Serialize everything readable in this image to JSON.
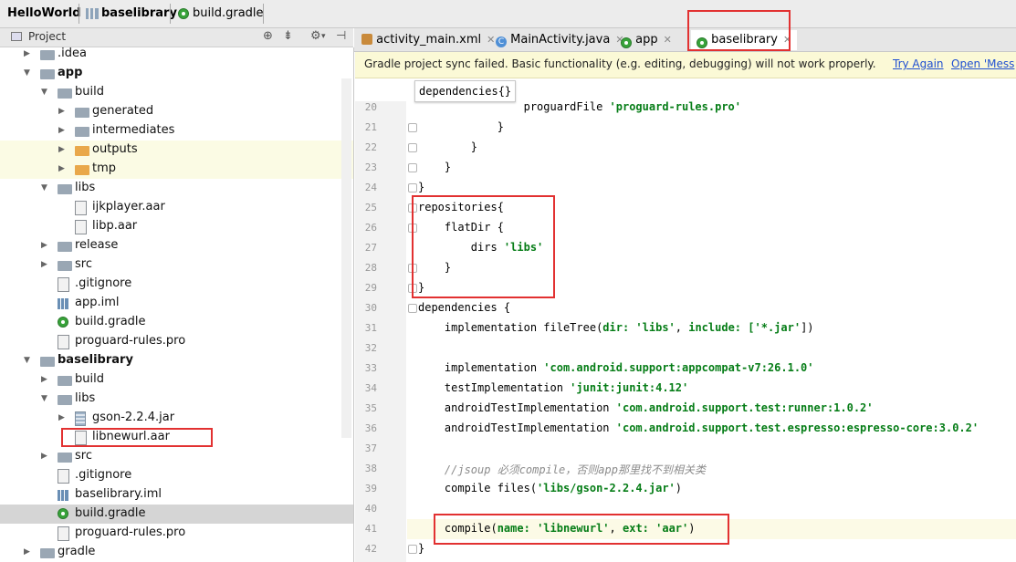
{
  "breadcrumb": [
    "HelloWorld",
    "baselibrary",
    "build.gradle"
  ],
  "project_panel": {
    "title": "Project",
    "tools": [
      "target-icon",
      "collapse-icon",
      "gear-icon",
      "hide-icon"
    ]
  },
  "tree": [
    {
      "label": ".idea",
      "indent": 1,
      "arrow": "right",
      "icon": "folder"
    },
    {
      "label": "app",
      "indent": 1,
      "arrow": "down",
      "icon": "module",
      "bold": true
    },
    {
      "label": "build",
      "indent": 2,
      "arrow": "down",
      "icon": "folder"
    },
    {
      "label": "generated",
      "indent": 3,
      "arrow": "right",
      "icon": "folder"
    },
    {
      "label": "intermediates",
      "indent": 3,
      "arrow": "right",
      "icon": "folder"
    },
    {
      "label": "outputs",
      "indent": 3,
      "arrow": "right",
      "icon": "folder-orange",
      "highlight": true
    },
    {
      "label": "tmp",
      "indent": 3,
      "arrow": "right",
      "icon": "folder-orange",
      "highlight": true
    },
    {
      "label": "libs",
      "indent": 2,
      "arrow": "down",
      "icon": "folder"
    },
    {
      "label": "ijkplayer.aar",
      "indent": 3,
      "arrow": "none",
      "icon": "file"
    },
    {
      "label": "libp.aar",
      "indent": 3,
      "arrow": "none",
      "icon": "file"
    },
    {
      "label": "release",
      "indent": 2,
      "arrow": "right",
      "icon": "folder"
    },
    {
      "label": "src",
      "indent": 2,
      "arrow": "right",
      "icon": "folder"
    },
    {
      "label": ".gitignore",
      "indent": 2,
      "arrow": "none",
      "icon": "file"
    },
    {
      "label": "app.iml",
      "indent": 2,
      "arrow": "none",
      "icon": "iml"
    },
    {
      "label": "build.gradle",
      "indent": 2,
      "arrow": "none",
      "icon": "gradle"
    },
    {
      "label": "proguard-rules.pro",
      "indent": 2,
      "arrow": "none",
      "icon": "file"
    },
    {
      "label": "baselibrary",
      "indent": 1,
      "arrow": "down",
      "icon": "module",
      "bold": true
    },
    {
      "label": "build",
      "indent": 2,
      "arrow": "right",
      "icon": "folder"
    },
    {
      "label": "libs",
      "indent": 2,
      "arrow": "down",
      "icon": "folder"
    },
    {
      "label": "gson-2.2.4.jar",
      "indent": 3,
      "arrow": "right",
      "icon": "jar"
    },
    {
      "label": "libnewurl.aar",
      "indent": 3,
      "arrow": "none",
      "icon": "file"
    },
    {
      "label": "src",
      "indent": 2,
      "arrow": "right",
      "icon": "folder"
    },
    {
      "label": ".gitignore",
      "indent": 2,
      "arrow": "none",
      "icon": "file"
    },
    {
      "label": "baselibrary.iml",
      "indent": 2,
      "arrow": "none",
      "icon": "iml"
    },
    {
      "label": "build.gradle",
      "indent": 2,
      "arrow": "none",
      "icon": "gradle",
      "selected": true
    },
    {
      "label": "proguard-rules.pro",
      "indent": 2,
      "arrow": "none",
      "icon": "file"
    },
    {
      "label": "gradle",
      "indent": 1,
      "arrow": "right",
      "icon": "folder"
    }
  ],
  "tabs": [
    {
      "label": "activity_main.xml",
      "icon": "xml-icon"
    },
    {
      "label": "MainActivity.java",
      "icon": "class-icon"
    },
    {
      "label": "app",
      "icon": "gradle-icon"
    },
    {
      "label": "baselibrary",
      "icon": "gradle-icon",
      "active": true
    }
  ],
  "notification": {
    "message": "Gradle project sync failed. Basic functionality (e.g. editing, debugging) will not work properly.",
    "try_again": "Try Again",
    "open_messages": "Open 'Mess"
  },
  "hint": "dependencies{}",
  "code_lines": [
    {
      "n": "20",
      "segs": [
        {
          "t": "                proguardFile "
        },
        {
          "t": "'proguard-rules.pro'",
          "c": "str"
        }
      ]
    },
    {
      "n": "21",
      "segs": [
        {
          "t": "            }"
        }
      ]
    },
    {
      "n": "22",
      "segs": [
        {
          "t": "        }"
        }
      ]
    },
    {
      "n": "23",
      "segs": [
        {
          "t": "    }"
        }
      ]
    },
    {
      "n": "24",
      "segs": [
        {
          "t": "}"
        }
      ]
    },
    {
      "n": "25",
      "segs": [
        {
          "t": "repositories{"
        }
      ]
    },
    {
      "n": "26",
      "segs": [
        {
          "t": "    flatDir {"
        }
      ]
    },
    {
      "n": "27",
      "segs": [
        {
          "t": "        dirs "
        },
        {
          "t": "'libs'",
          "c": "str"
        }
      ]
    },
    {
      "n": "28",
      "segs": [
        {
          "t": "    }"
        }
      ]
    },
    {
      "n": "29",
      "segs": [
        {
          "t": "}"
        }
      ]
    },
    {
      "n": "30",
      "segs": [
        {
          "t": "dependencies {"
        }
      ]
    },
    {
      "n": "31",
      "segs": [
        {
          "t": "    implementation fileTree("
        },
        {
          "t": "dir: ",
          "c": "nm"
        },
        {
          "t": "'libs'",
          "c": "str"
        },
        {
          "t": ", "
        },
        {
          "t": "include: ",
          "c": "nm"
        },
        {
          "t": "['*.jar'",
          "c": "str"
        },
        {
          "t": "])"
        }
      ]
    },
    {
      "n": "32",
      "segs": []
    },
    {
      "n": "33",
      "segs": [
        {
          "t": "    implementation "
        },
        {
          "t": "'com.android.support:appcompat-v7:26.1.0'",
          "c": "str"
        }
      ]
    },
    {
      "n": "34",
      "segs": [
        {
          "t": "    testImplementation "
        },
        {
          "t": "'junit:junit:4.12'",
          "c": "str"
        }
      ]
    },
    {
      "n": "35",
      "segs": [
        {
          "t": "    androidTestImplementation "
        },
        {
          "t": "'com.android.support.test:runner:1.0.2'",
          "c": "str"
        }
      ]
    },
    {
      "n": "36",
      "segs": [
        {
          "t": "    androidTestImplementation "
        },
        {
          "t": "'com.android.support.test.espresso:espresso-core:3.0.2'",
          "c": "str"
        }
      ]
    },
    {
      "n": "37",
      "segs": []
    },
    {
      "n": "38",
      "segs": [
        {
          "t": "    //jsoup 必须compile，否则app那里找不到相关类",
          "c": "cmt"
        }
      ]
    },
    {
      "n": "39",
      "segs": [
        {
          "t": "    compile files("
        },
        {
          "t": "'libs/gson-2.2.4.jar'",
          "c": "str"
        },
        {
          "t": ")"
        }
      ]
    },
    {
      "n": "40",
      "segs": []
    },
    {
      "n": "41",
      "segs": [
        {
          "t": "    compile("
        },
        {
          "t": "name: ",
          "c": "nm"
        },
        {
          "t": "'libnewurl'",
          "c": "str"
        },
        {
          "t": ", "
        },
        {
          "t": "ext: ",
          "c": "nm"
        },
        {
          "t": "'aar'",
          "c": "str"
        },
        {
          "t": ")"
        }
      ]
    },
    {
      "n": "42",
      "segs": [
        {
          "t": "}"
        }
      ]
    }
  ],
  "colors": {
    "annotation": "#e23131",
    "link": "#1f4fd1",
    "string": "#067d17"
  }
}
